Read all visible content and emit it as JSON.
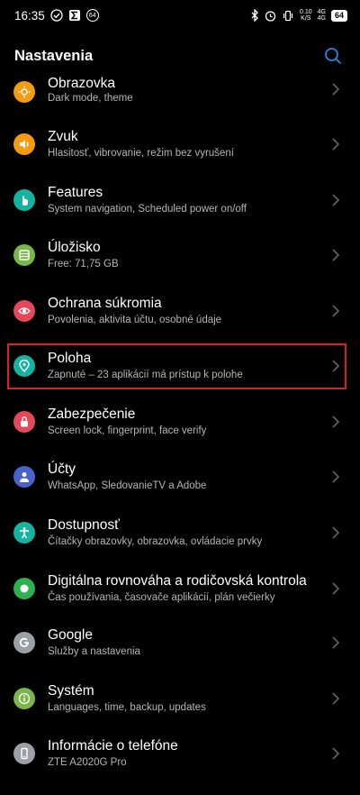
{
  "status_bar": {
    "time": "16:35",
    "badge": "64",
    "speed": "0.10\nK/S",
    "network": "4G\n4G",
    "battery": "64"
  },
  "header": {
    "title": "Nastavenia",
    "search_icon": "search-icon"
  },
  "settings": [
    {
      "label": "Obrazovka",
      "sub": "Dark mode, theme",
      "icon": "brightness-icon",
      "color": "#f39c12"
    },
    {
      "label": "Zvuk",
      "sub": "Hlasitosť, vibrovanie, režim bez vyrušení",
      "icon": "speaker-icon",
      "color": "#f39c12"
    },
    {
      "label": "Features",
      "sub": "System navigation, Scheduled power on/off",
      "icon": "hand-icon",
      "color": "#16b3a0"
    },
    {
      "label": "Úložisko",
      "sub": "Free: 71,75 GB",
      "icon": "storage-icon",
      "color": "#7ab648"
    },
    {
      "label": "Ochrana súkromia",
      "sub": "Povolenia, aktivita účtu, osobné údaje",
      "icon": "privacy-eye-icon",
      "color": "#e5485b"
    },
    {
      "label": "Poloha",
      "sub": "Zapnuté – 23 aplikácií má prístup k polohe",
      "icon": "location-pin-icon",
      "color": "#16b3a0"
    },
    {
      "label": "Zabezpečenie",
      "sub": "Screen lock, fingerprint, face verify",
      "icon": "lock-icon",
      "color": "#e5485b"
    },
    {
      "label": "Účty",
      "sub": "WhatsApp, SledovanieTV a Adobe",
      "icon": "person-icon",
      "color": "#4a62c9"
    },
    {
      "label": "Dostupnosť",
      "sub": "Čítačky obrazovky, obrazovka, ovládacie prvky",
      "icon": "accessibility-icon",
      "color": "#16b3a0"
    },
    {
      "label": "Digitálna rovnováha a rodičovská kontrola",
      "sub": "Čas používania, časovače aplikácií, plán večierky",
      "icon": "wellbeing-icon",
      "color": "#2db14e"
    },
    {
      "label": "Google",
      "sub": "Služby a nastavenia",
      "icon": "google-icon",
      "color": "#9aa0a6"
    },
    {
      "label": "Systém",
      "sub": "Languages, time, backup, updates",
      "icon": "info-icon",
      "color": "#7ab648"
    },
    {
      "label": "Informácie o telefóne",
      "sub": "ZTE A2020G Pro",
      "icon": "phone-icon",
      "color": "#9aa0a6"
    }
  ],
  "colors": {
    "accent": "#1e88e5",
    "highlight": "#e0201f"
  }
}
